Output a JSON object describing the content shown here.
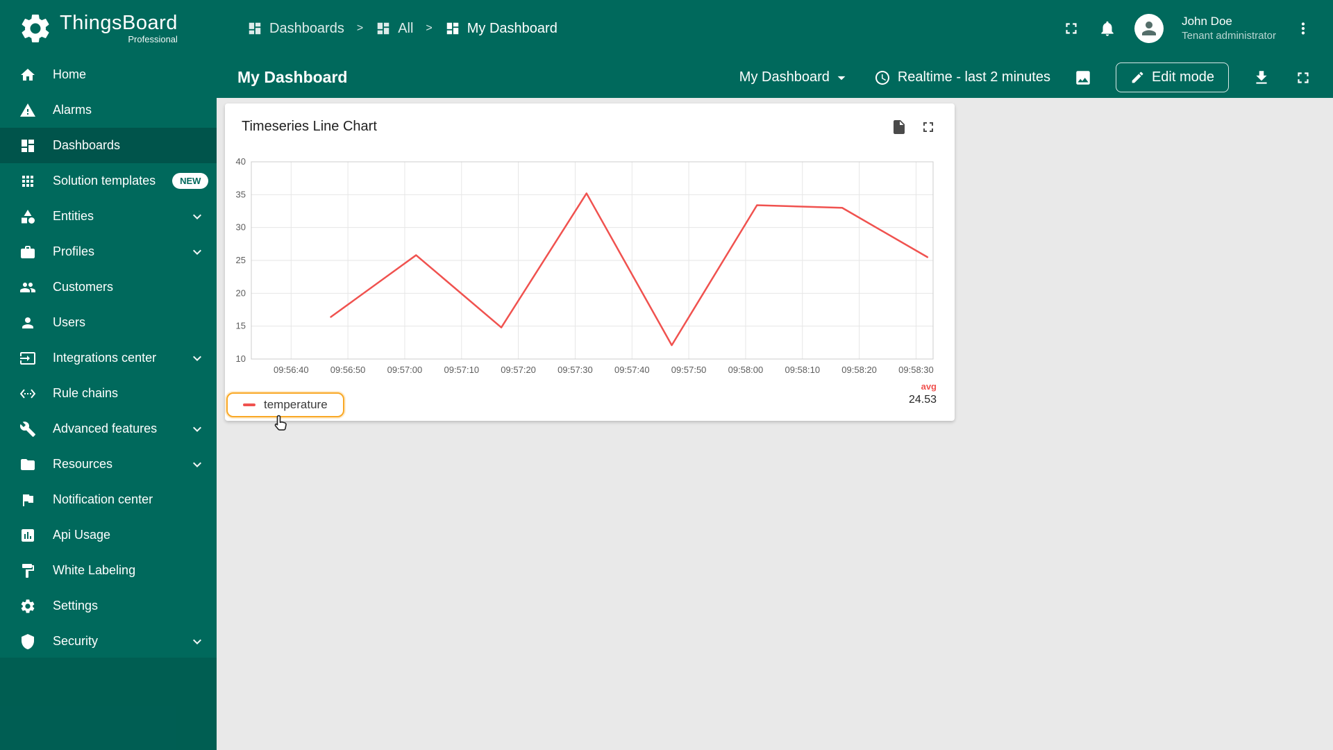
{
  "brand": {
    "name": "ThingsBoard",
    "edition": "Professional"
  },
  "header": {
    "breadcrumb": [
      {
        "label": "Dashboards",
        "icon": "dashboards-icon"
      },
      {
        "label": "All",
        "icon": "dashboards-icon"
      },
      {
        "label": "My Dashboard",
        "icon": "dashboards-icon"
      }
    ],
    "separator": ">",
    "user": {
      "name": "John Doe",
      "role": "Tenant administrator"
    }
  },
  "toolbar": {
    "page_title": "My Dashboard",
    "dashboard_selector": "My Dashboard",
    "timewindow": "Realtime - last 2 minutes",
    "edit_button": "Edit mode"
  },
  "sidebar": {
    "items": [
      {
        "label": "Home",
        "icon": "home-icon"
      },
      {
        "label": "Alarms",
        "icon": "alarm-icon"
      },
      {
        "label": "Dashboards",
        "icon": "dashboards-icon",
        "active": true
      },
      {
        "label": "Solution templates",
        "icon": "apps-icon",
        "badge": "NEW"
      },
      {
        "label": "Entities",
        "icon": "entities-icon",
        "expandable": true
      },
      {
        "label": "Profiles",
        "icon": "profiles-icon",
        "expandable": true
      },
      {
        "label": "Customers",
        "icon": "customers-icon"
      },
      {
        "label": "Users",
        "icon": "user-icon"
      },
      {
        "label": "Integrations center",
        "icon": "integrations-icon",
        "expandable": true
      },
      {
        "label": "Rule chains",
        "icon": "rule-chains-icon"
      },
      {
        "label": "Advanced features",
        "icon": "advanced-icon",
        "expandable": true
      },
      {
        "label": "Resources",
        "icon": "resources-icon",
        "expandable": true
      },
      {
        "label": "Notification center",
        "icon": "notification-icon"
      },
      {
        "label": "Api Usage",
        "icon": "api-usage-icon"
      },
      {
        "label": "White Labeling",
        "icon": "white-labeling-icon"
      },
      {
        "label": "Settings",
        "icon": "settings-icon"
      },
      {
        "label": "Security",
        "icon": "security-icon",
        "expandable": true
      }
    ]
  },
  "widget": {
    "title": "Timeseries Line Chart",
    "legend": {
      "series": "temperature",
      "agg_label": "avg",
      "agg_value": "24.53"
    }
  },
  "chart_data": {
    "type": "line",
    "title": "Timeseries Line Chart",
    "x_start_time": "09:56:33",
    "x_range_s": [
      0,
      120
    ],
    "x_tick_offsets_s": [
      7,
      17,
      27,
      37,
      47,
      57,
      67,
      77,
      87,
      97,
      107,
      117
    ],
    "x_tick_labels": [
      "09:56:40",
      "09:56:50",
      "09:57:00",
      "09:57:10",
      "09:57:20",
      "09:57:30",
      "09:57:40",
      "09:57:50",
      "09:58:00",
      "09:58:10",
      "09:58:20",
      "09:58:30"
    ],
    "ylim": [
      10,
      40
    ],
    "y_ticks": [
      10,
      15,
      20,
      25,
      30,
      35,
      40
    ],
    "grid": true,
    "legend_position": "bottom",
    "series": [
      {
        "name": "temperature",
        "color": "#f0524f",
        "avg": 24.53,
        "points": [
          {
            "time": "09:56:47",
            "offset_s": 14,
            "value": 16.4
          },
          {
            "time": "09:57:02",
            "offset_s": 29,
            "value": 25.8
          },
          {
            "time": "09:57:17",
            "offset_s": 44,
            "value": 14.8
          },
          {
            "time": "09:57:32",
            "offset_s": 59,
            "value": 35.2
          },
          {
            "time": "09:57:47",
            "offset_s": 74,
            "value": 12.1
          },
          {
            "time": "09:58:02",
            "offset_s": 89,
            "value": 33.4
          },
          {
            "time": "09:58:17",
            "offset_s": 104,
            "value": 33.0
          },
          {
            "time": "09:58:32",
            "offset_s": 119,
            "value": 25.5
          }
        ]
      }
    ]
  },
  "colors": {
    "primary": "#00695c",
    "sidebar_active": "#00544b",
    "content_background": "#e9e9e9",
    "series_line": "#f0524f",
    "avg_label": "#f0524f",
    "legend_highlight": "#f9a825",
    "badge_text": "#00695c"
  }
}
